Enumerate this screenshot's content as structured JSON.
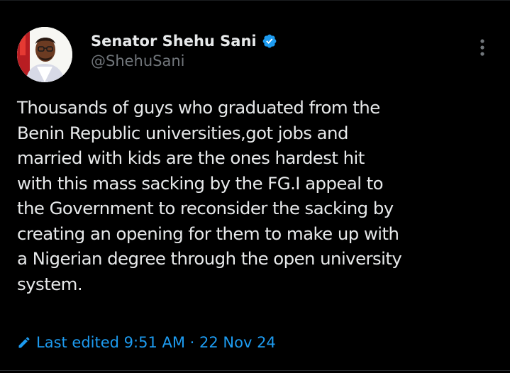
{
  "author": {
    "display_name": "Senator Shehu Sani",
    "handle": "@ShehuSani",
    "verified": true,
    "avatar": "avatar-photo"
  },
  "tweet": {
    "text": "Thousands of guys who graduated from the\nBenin Republic universities,got jobs and\nmarried with kids are the ones hardest hit\nwith this mass sacking by the FG.I appeal to\nthe Government to reconsider the sacking by\ncreating an opening for them to make up with\na Nigerian degree through the open university\nsystem."
  },
  "edited": {
    "label": "Last edited 9:51 AM · 22 Nov 24",
    "icon": "pencil-icon"
  },
  "icons": {
    "verified": "verified-badge-icon",
    "more": "more-vertical-icon"
  },
  "colors": {
    "background": "#000000",
    "text": "#e7e9ea",
    "secondary": "#71767b",
    "accent": "#1d9bf0"
  }
}
